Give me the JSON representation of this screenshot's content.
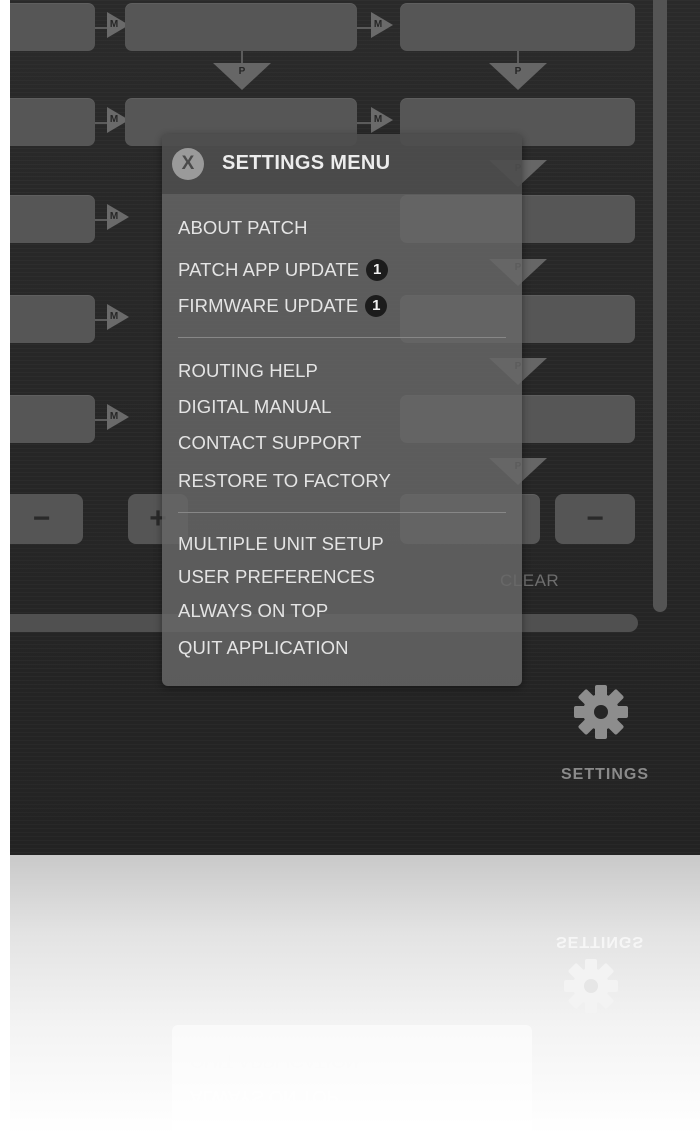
{
  "window": {
    "accent": "#1c1c1c",
    "menu_bg": "#666666"
  },
  "routing": {
    "mixer_label": "M",
    "patch_label": "P"
  },
  "controls": {
    "minus_label": "−",
    "plus_label": "+",
    "clear_label": "CLEAR"
  },
  "settings_button": {
    "icon": "gear-icon",
    "label": "SETTINGS"
  },
  "menu": {
    "close_icon": "close-icon",
    "close_glyph": "X",
    "title": "SETTINGS MENU",
    "items": [
      {
        "label": "ABOUT PATCH"
      },
      {
        "label": "PATCH APP UPDATE",
        "badge": "1"
      },
      {
        "label": "FIRMWARE UPDATE",
        "badge": "1"
      },
      {
        "label": "ROUTING HELP"
      },
      {
        "label": "DIGITAL MANUAL"
      },
      {
        "label": "CONTACT SUPPORT"
      },
      {
        "label": "RESTORE TO FACTORY"
      },
      {
        "label": "MULTIPLE UNIT SETUP"
      },
      {
        "label": "USER PREFERENCES"
      },
      {
        "label": "ALWAYS ON TOP"
      },
      {
        "label": "QUIT APPLICATION"
      }
    ]
  },
  "reflection": {
    "settings_label": "SETTINGS",
    "quit_label": "QUIT APPLICATION",
    "always_label": "ALWAYS ON TOP"
  }
}
